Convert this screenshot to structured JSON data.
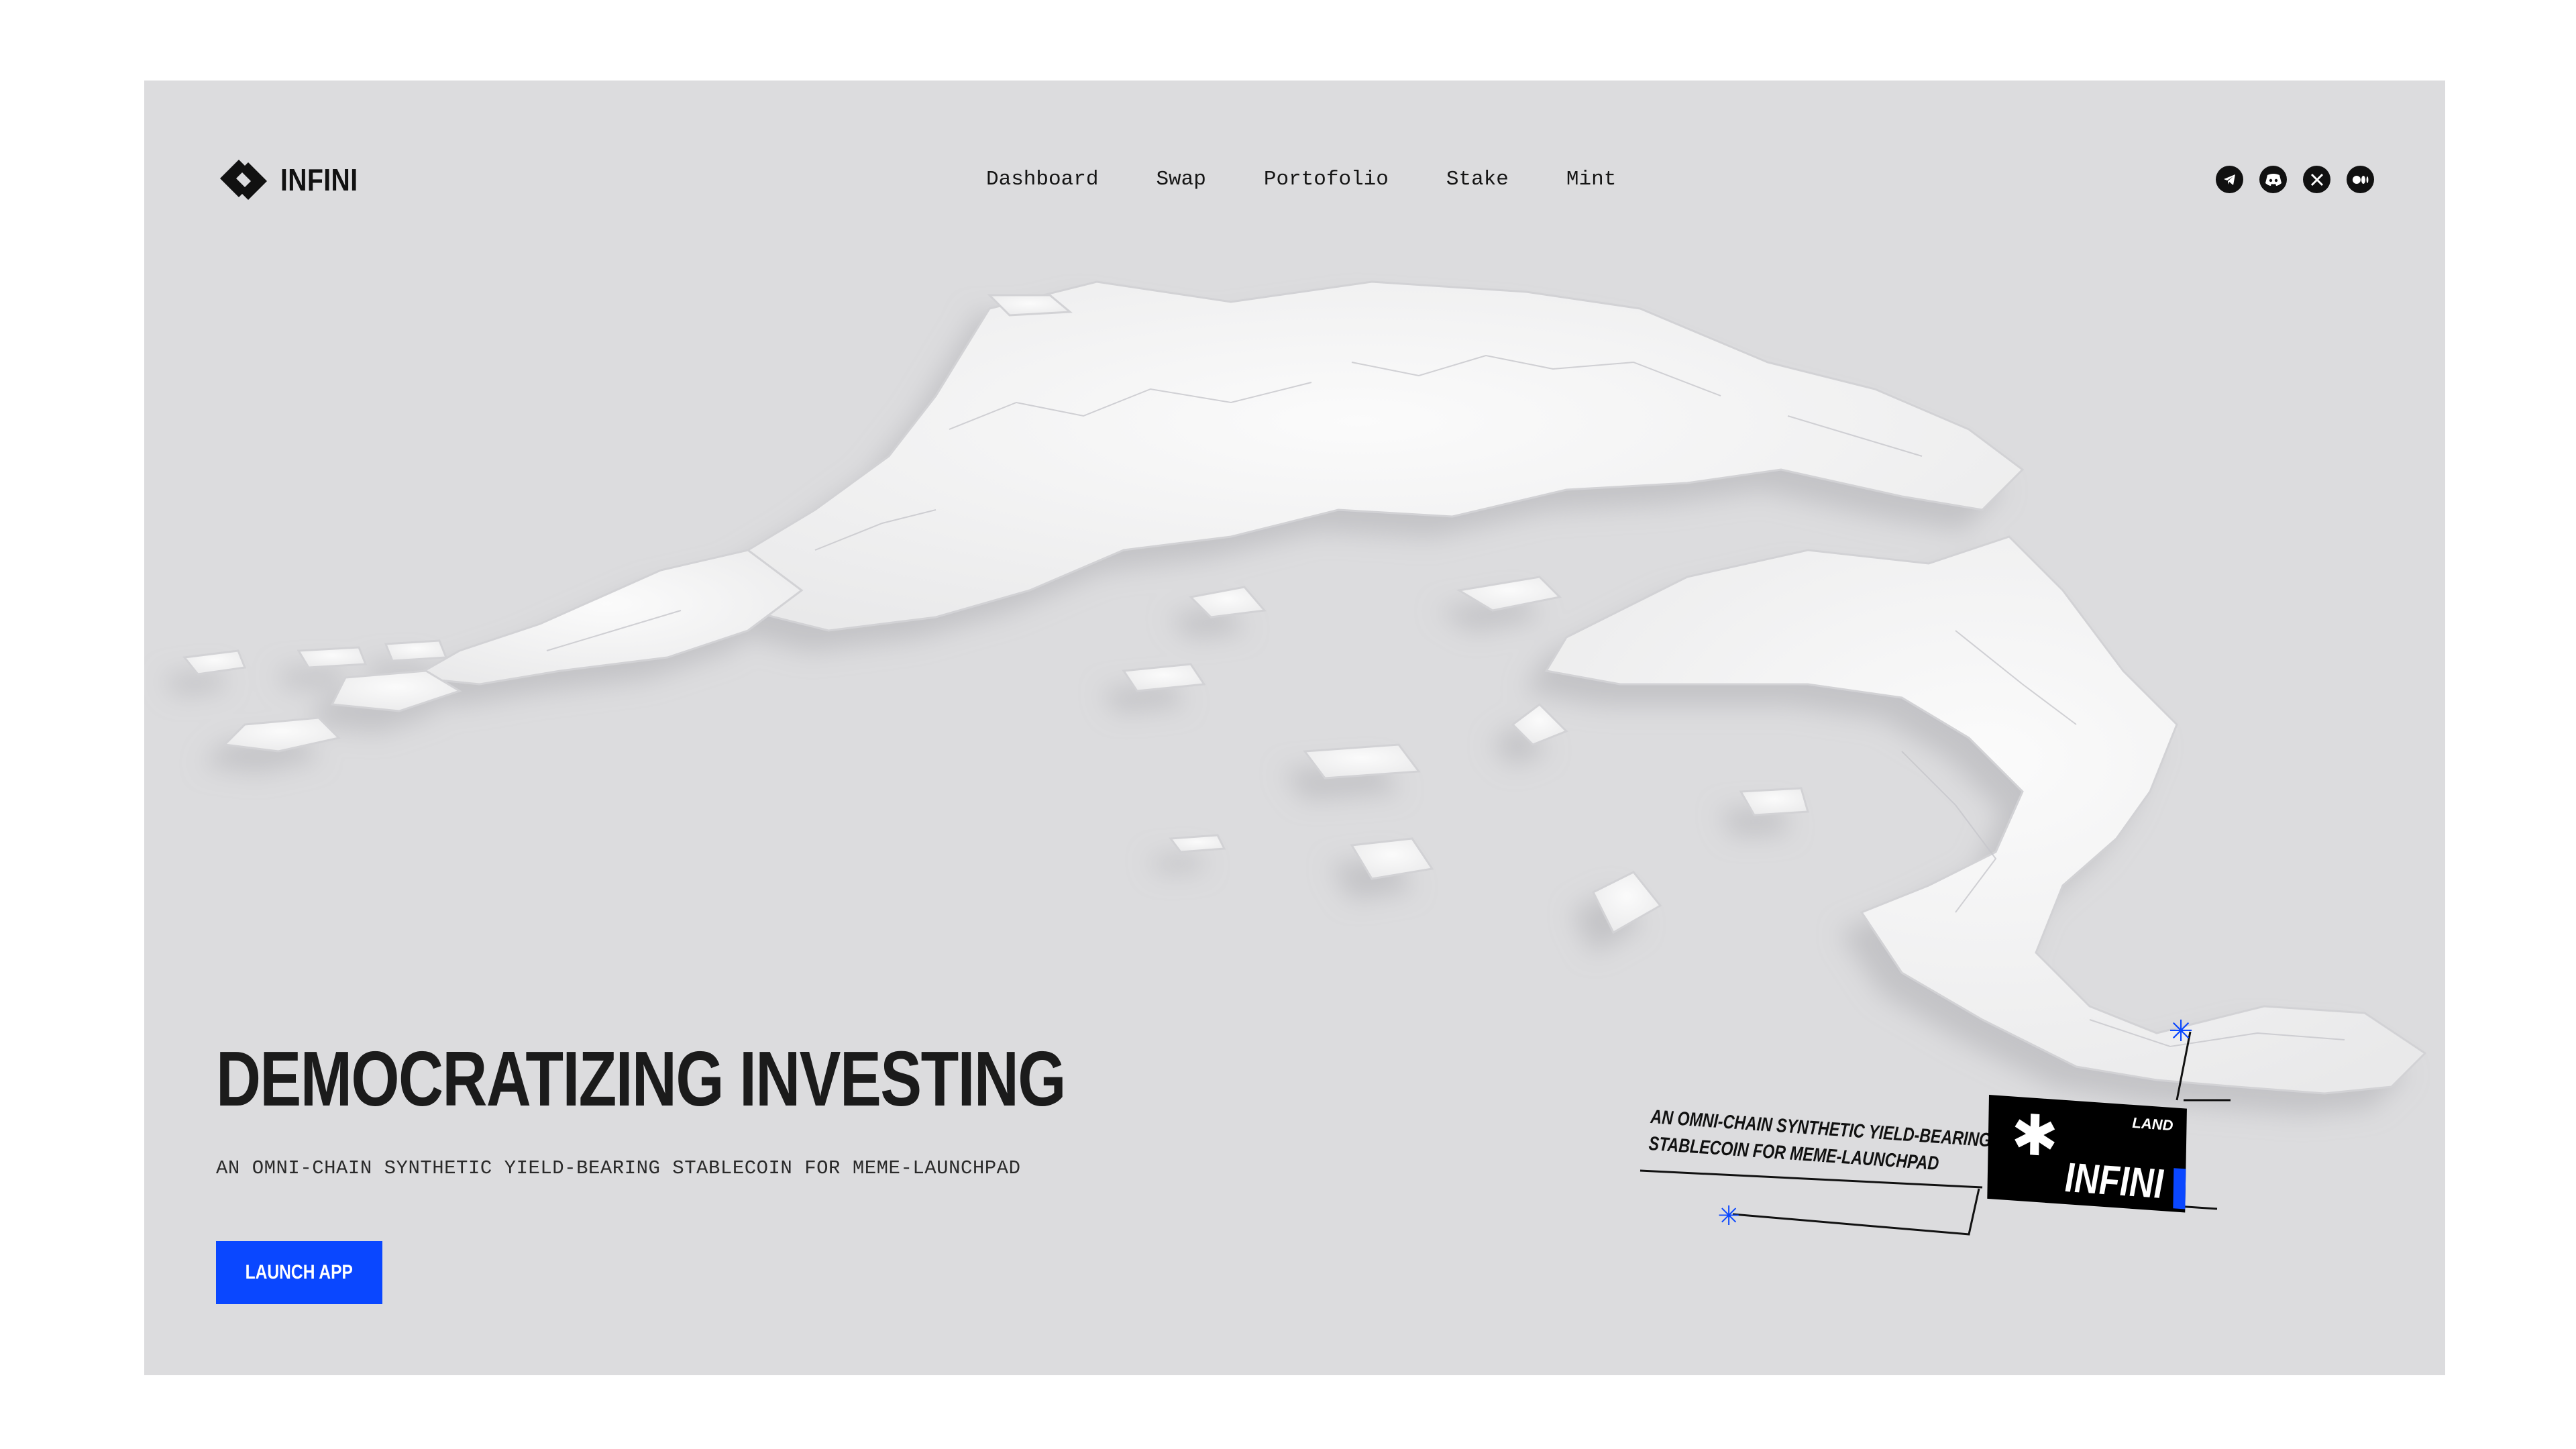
{
  "brand": {
    "name": "INFINI",
    "logo_icon": "infini-chevron-logo"
  },
  "nav": {
    "items": [
      {
        "label": "Dashboard"
      },
      {
        "label": "Swap"
      },
      {
        "label": "Portofolio"
      },
      {
        "label": "Stake"
      },
      {
        "label": "Mint"
      }
    ]
  },
  "social": {
    "icons": [
      "telegram-icon",
      "discord-icon",
      "x-icon",
      "medium-icon"
    ]
  },
  "hero": {
    "title": "DEMOCRATIZING INVESTING",
    "subtitle": "AN OMNI-CHAIN SYNTHETIC YIELD-BEARING STABLECOIN FOR MEME-LAUNCHPAD",
    "cta_label": "LAUNCH APP"
  },
  "map_badge": {
    "tagline_line1": "AN OMNI-CHAIN SYNTHETIC YIELD-BEARING",
    "tagline_line2": "STABLECOIN FOR MEME-LAUNCHPAD",
    "land_label": "LAND",
    "name": "INFINI"
  },
  "colors": {
    "accent": "#0a47ff",
    "background": "#dcdcde",
    "text": "#1b1b1b"
  }
}
